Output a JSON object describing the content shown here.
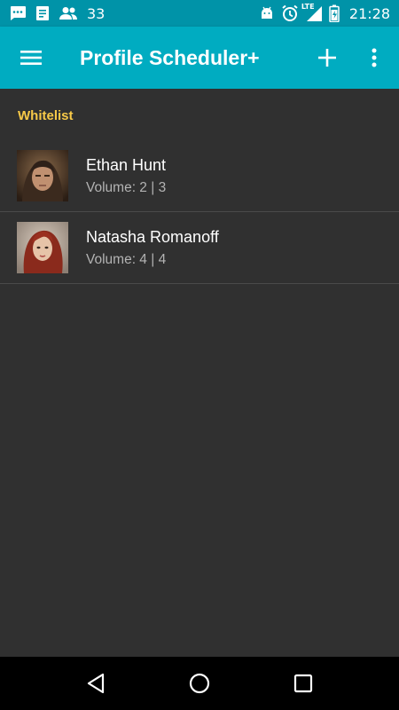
{
  "status_bar": {
    "notification_count": "33",
    "network": "LTE",
    "time": "21:28"
  },
  "app_bar": {
    "title": "Profile Scheduler+"
  },
  "section": {
    "title": "Whitelist"
  },
  "contacts": [
    {
      "name": "Ethan Hunt",
      "volume": "Volume: 2 | 3"
    },
    {
      "name": "Natasha Romanoff",
      "volume": "Volume: 4 | 4"
    }
  ],
  "colors": {
    "status_bar": "#0093a8",
    "app_bar": "#00acc1",
    "background": "#303030",
    "section_header": "#f7c948",
    "nav_bar": "#000000"
  },
  "icons": {
    "status_left": [
      "chat-bubble-icon",
      "document-icon",
      "people-icon"
    ],
    "status_right": [
      "android-icon",
      "alarm-icon",
      "signal-lte-icon",
      "battery-icon"
    ],
    "app_bar": [
      "hamburger-menu-icon",
      "add-icon",
      "more-vert-icon"
    ],
    "nav_bar": [
      "back-icon",
      "home-icon",
      "recents-icon"
    ]
  }
}
